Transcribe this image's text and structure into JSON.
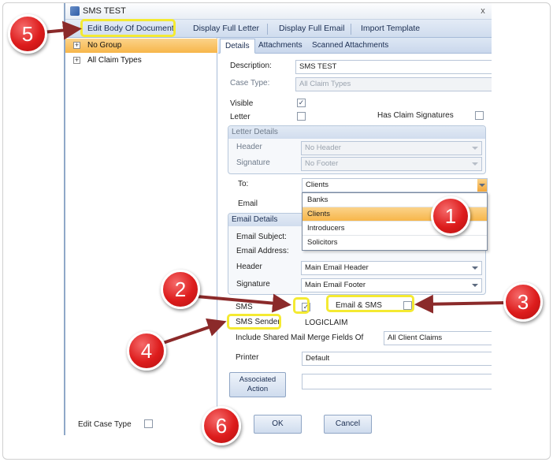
{
  "window": {
    "title": "SMS TEST",
    "close_glyph": "x"
  },
  "menubar": {
    "items": [
      "Edit Body Of Document",
      "Display Full Letter",
      "Display Full Email",
      "Import Template"
    ]
  },
  "tree": {
    "items": [
      {
        "label": "No Group",
        "expander": "+"
      },
      {
        "label": "All Claim Types",
        "expander": "+"
      }
    ],
    "edit_case_type_label": "Edit Case Type"
  },
  "tabs": [
    "Details",
    "Attachments",
    "Scanned Attachments"
  ],
  "details": {
    "description_label": "Description:",
    "description_value": "SMS TEST",
    "case_type_label": "Case Type:",
    "case_type_value": "All Claim Types",
    "visible_label": "Visible",
    "visible_checked": "✓",
    "letter_label": "Letter",
    "has_claim_signatures_label": "Has Claim Signatures",
    "letter_details": {
      "title": "Letter Details",
      "header_label": "Header",
      "header_value": "No Header",
      "signature_label": "Signature",
      "signature_value": "No Footer"
    },
    "to_label": "To:",
    "to_value": "Clients",
    "email_label": "Email",
    "to_options": [
      "Banks",
      "Clients",
      "Introducers",
      "Solicitors"
    ],
    "email_details": {
      "title": "Email Details",
      "subject_label": "Email Subject:",
      "address_label": "Email Address:",
      "header_label": "Header",
      "header_value": "Main Email Header",
      "signature_label": "Signature",
      "signature_value": "Main Email Footer"
    },
    "sms_label": "SMS",
    "sms_checked": "✓",
    "email_sms_label": "Email & SMS",
    "sms_sender_label": "SMS Sender",
    "sms_sender_value": "LOGICLAIM",
    "shared_fields_label": "Include Shared Mail Merge Fields Of",
    "shared_fields_value": "All Client Claims",
    "printer_label": "Printer",
    "printer_value": "Default",
    "associated_action_label": "Associated Action"
  },
  "buttons": {
    "ok": "OK",
    "cancel": "Cancel"
  },
  "callouts": [
    "1",
    "2",
    "3",
    "4",
    "5",
    "6"
  ],
  "colors": {
    "callout_red": "#dd1c1c",
    "highlight_yellow": "#f4ea32",
    "selection_orange": "#f7b64a",
    "arrow_color": "#8b2a2a"
  }
}
